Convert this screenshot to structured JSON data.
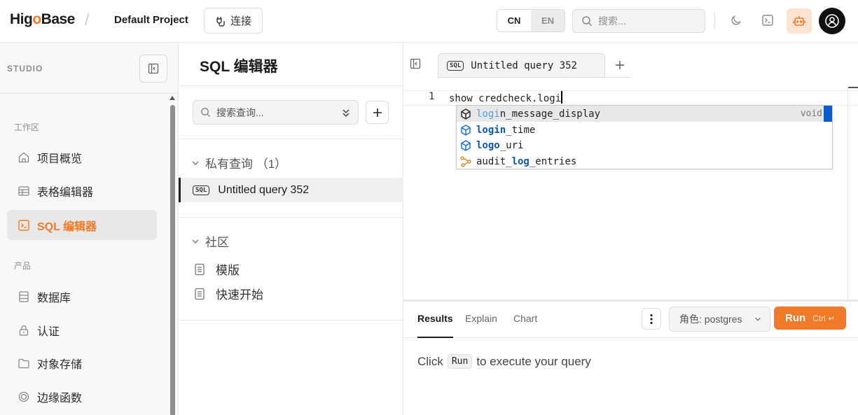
{
  "header": {
    "logo_pre": "Hig",
    "logo_dot": "o",
    "logo_post": "Base",
    "separator": "/",
    "project": "Default Project",
    "connect_label": "连接",
    "lang_cn": "CN",
    "lang_en": "EN",
    "search_placeholder": "搜索..."
  },
  "sidebar": {
    "studio_label": "STUDIO",
    "group_workspace": "工作区",
    "group_product": "产品",
    "items": [
      {
        "label": "项目概览",
        "icon": "home-icon"
      },
      {
        "label": "表格编辑器",
        "icon": "table-icon"
      },
      {
        "label": "SQL 编辑器",
        "icon": "terminal-icon"
      },
      {
        "label": "数据库",
        "icon": "database-icon"
      },
      {
        "label": "认证",
        "icon": "lock-icon"
      },
      {
        "label": "对象存储",
        "icon": "folder-icon"
      },
      {
        "label": "边缘函数",
        "icon": "function-icon"
      }
    ]
  },
  "middle": {
    "title": "SQL 编辑器",
    "search_placeholder": "搜索查询...",
    "private_section": "私有查询 （1）",
    "query_item": "Untitled query 352",
    "community_section": "社区",
    "docs": [
      "模版",
      "快速开始"
    ]
  },
  "editor": {
    "tab_label": "Untitled query 352",
    "line_number": "1",
    "code": "show credcheck.logi",
    "suggestions": [
      {
        "match": "logi",
        "rest": "n_message_display",
        "type": "void",
        "icon": "cube-outline-icon"
      },
      {
        "match": "login",
        "rest": "_time",
        "type": "",
        "icon": "cube-blue-icon"
      },
      {
        "match": "logo",
        "rest": "_uri",
        "type": "",
        "icon": "cube-blue-icon"
      },
      {
        "pre": "audit_",
        "match": "log",
        "rest": "_entries",
        "type": "",
        "icon": "relation-icon"
      }
    ],
    "sql_badge": "SQL"
  },
  "results": {
    "tabs": [
      "Results",
      "Explain",
      "Chart"
    ],
    "role_label": "角色: postgres",
    "run_label": "Run",
    "run_shortcut": "Ctrl ↵",
    "msg_pre": "Click",
    "msg_chip": "Run",
    "msg_post": "to execute your query"
  },
  "colors": {
    "accent": "#f07a28",
    "match_blue": "#0b56b3"
  }
}
